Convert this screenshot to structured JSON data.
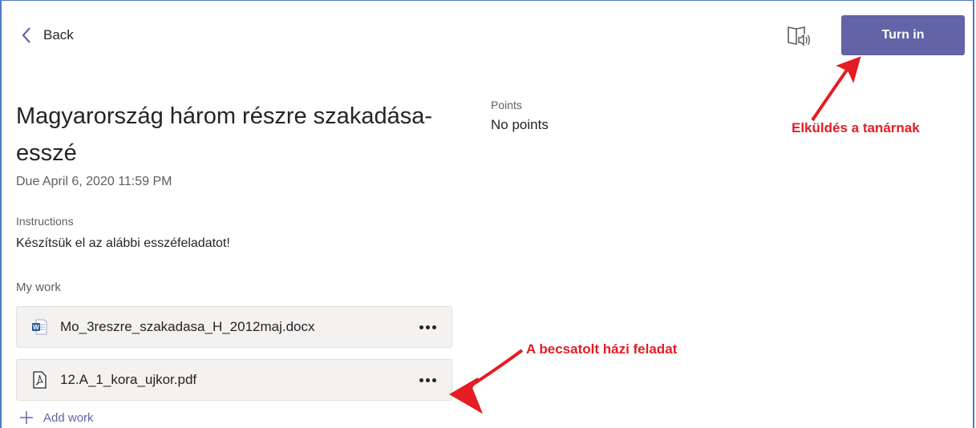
{
  "header": {
    "back_label": "Back",
    "turn_in_label": "Turn in",
    "reader_icon": "immersive-reader-icon"
  },
  "assignment": {
    "title": "Magyarország három részre szakadása-esszé",
    "due": "Due April 6, 2020 11:59 PM",
    "points_label": "Points",
    "points_value": "No points",
    "instructions_label": "Instructions",
    "instructions_text": "Készítsük el az alábbi esszéfeladatot!"
  },
  "my_work": {
    "label": "My work",
    "files": [
      {
        "name": "Mo_3reszre_szakadasa_H_2012maj.docx",
        "icon": "word-doc-icon"
      },
      {
        "name": "12.A_1_kora_ujkor.pdf",
        "icon": "pdf-icon"
      }
    ],
    "add_label": "Add work"
  },
  "annotations": {
    "turn_in_note": "Elküldés a tanárnak",
    "attachment_note": "A becsatolt házi feladat",
    "color": "#e51c23"
  },
  "colors": {
    "accent": "#6264a7",
    "frame": "#4f79c7"
  }
}
